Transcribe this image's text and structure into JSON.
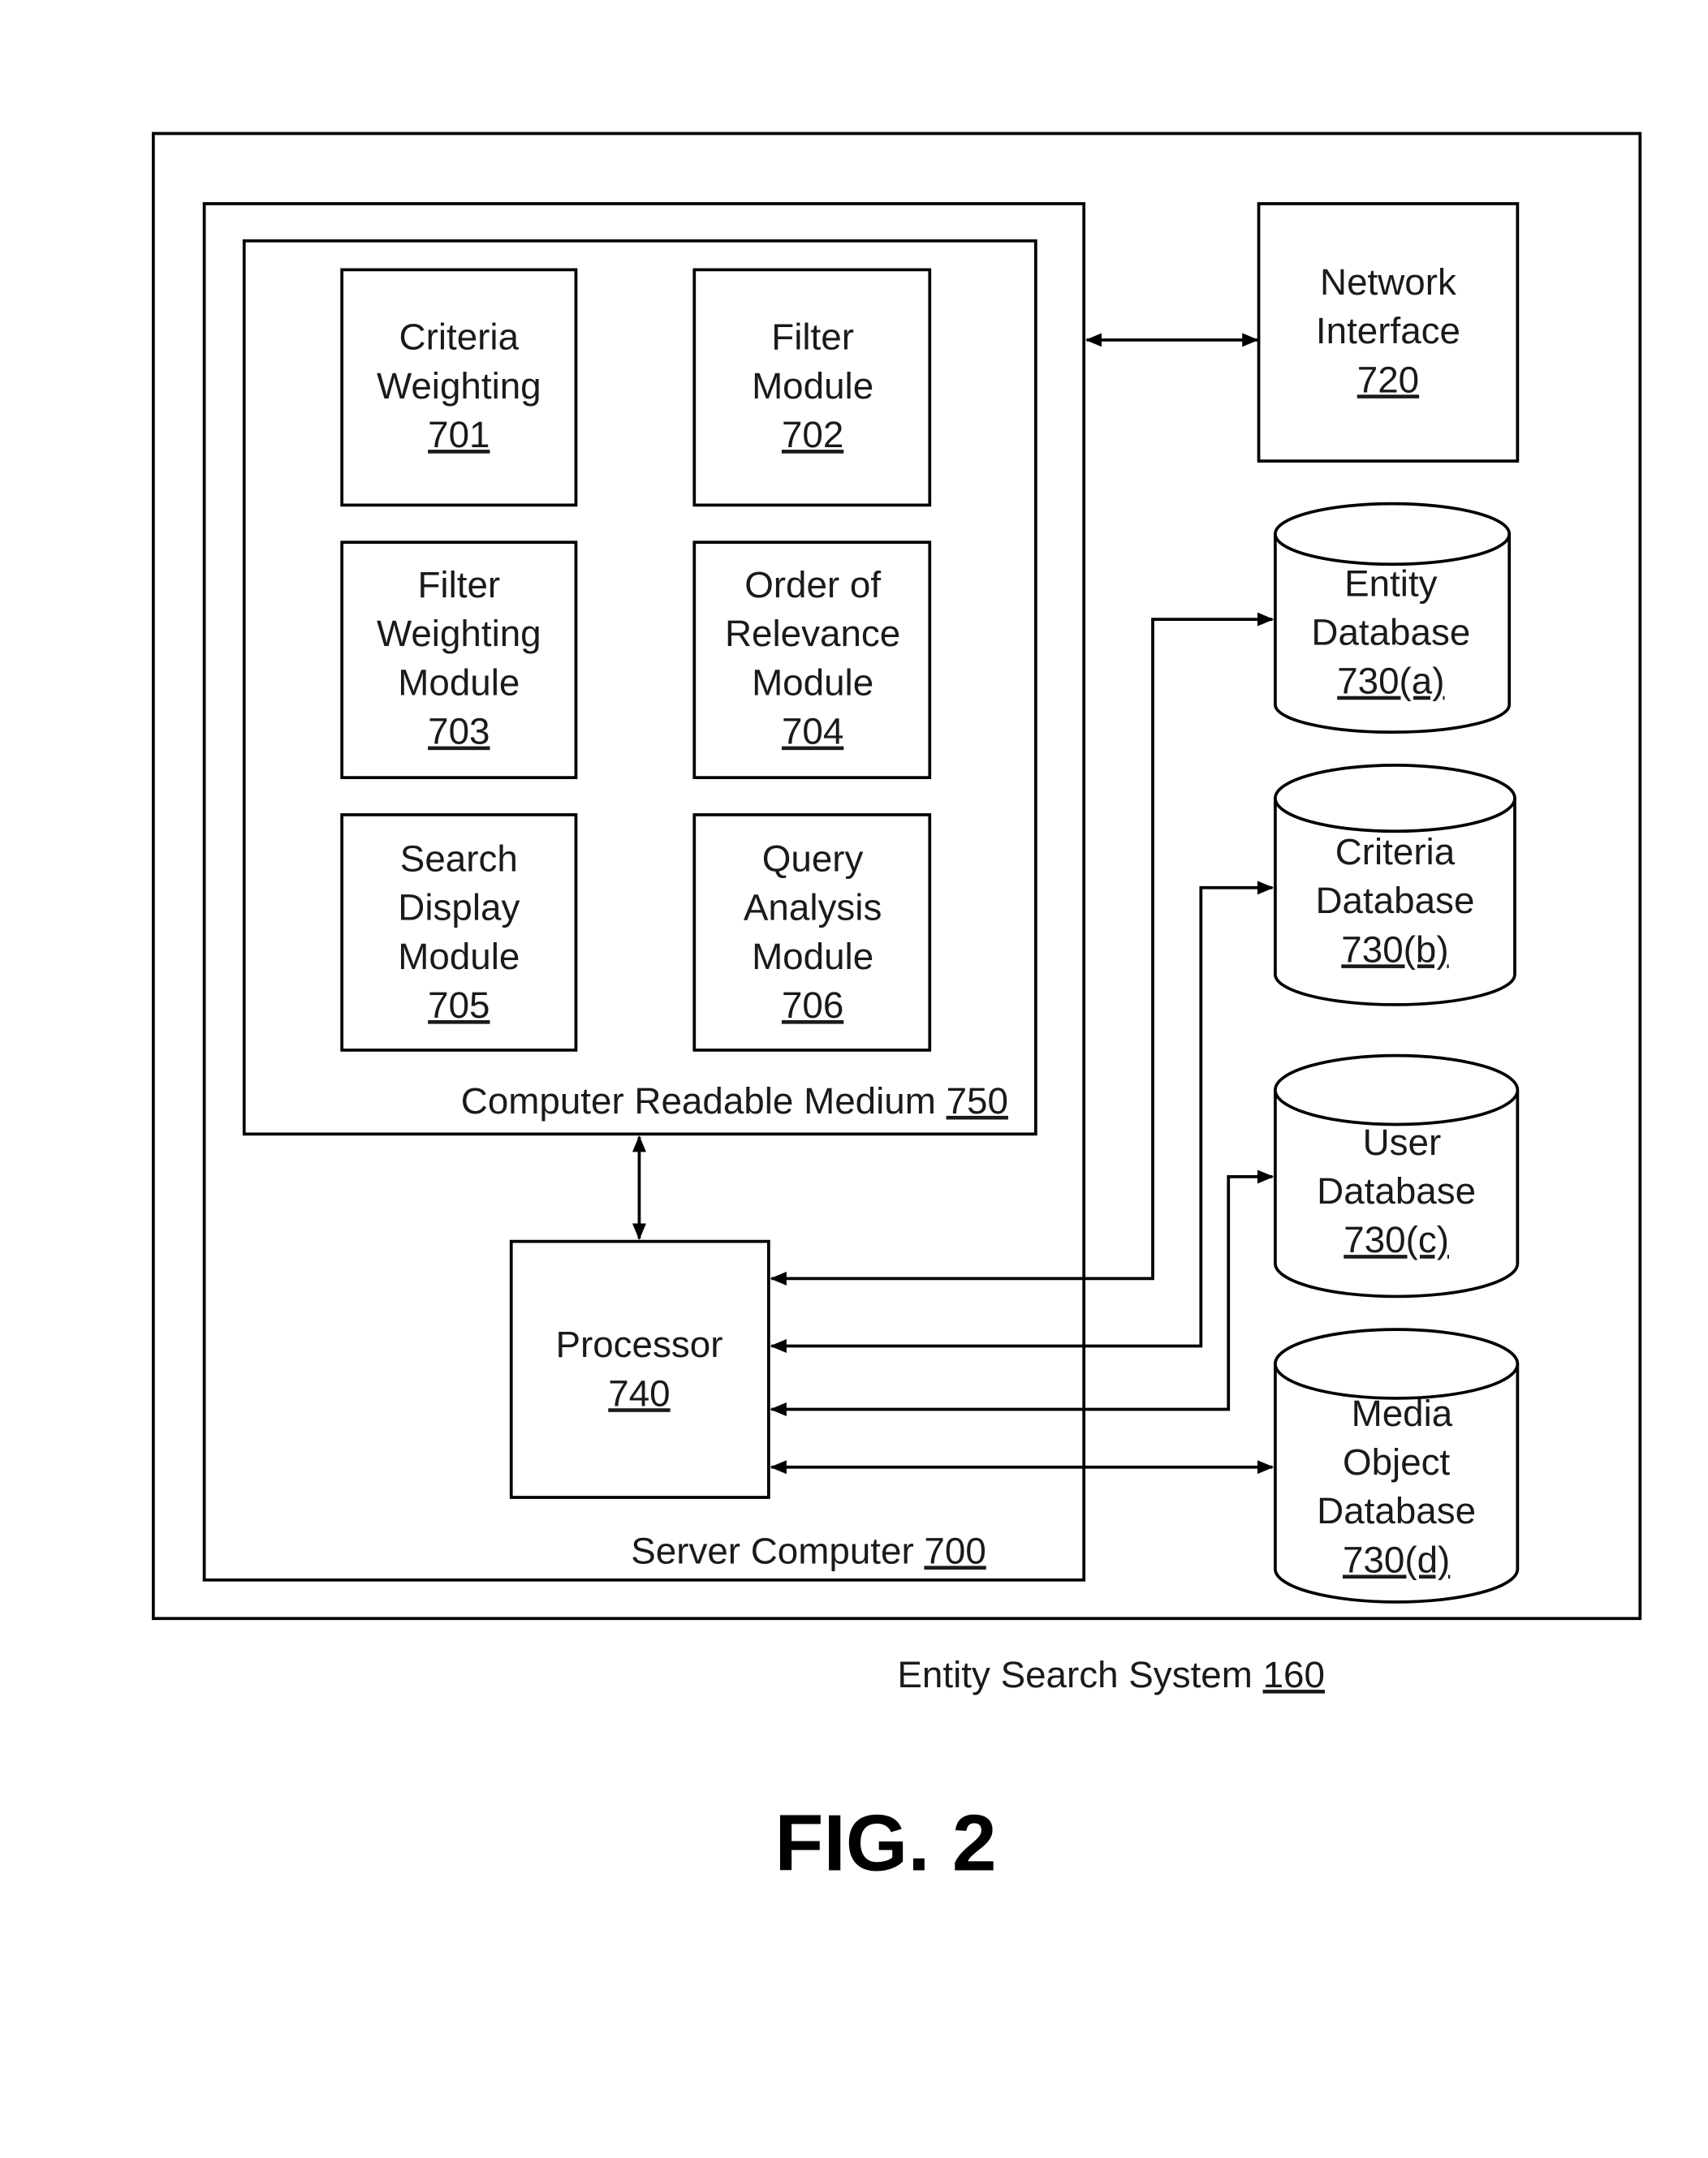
{
  "figure": {
    "label": "FIG. 2",
    "system": {
      "name": "Entity Search System",
      "ref": "160"
    },
    "server": {
      "name": "Server Computer",
      "ref": "700"
    },
    "medium": {
      "name": "Computer Readable Medium",
      "ref": "750"
    },
    "modules": [
      {
        "lines": [
          "Criteria",
          "Weighting"
        ],
        "ref": "701"
      },
      {
        "lines": [
          "Filter",
          "Module"
        ],
        "ref": "702"
      },
      {
        "lines": [
          "Filter",
          "Weighting",
          "Module"
        ],
        "ref": "703"
      },
      {
        "lines": [
          "Order of",
          "Relevance",
          "Module"
        ],
        "ref": "704"
      },
      {
        "lines": [
          "Search",
          "Display",
          "Module"
        ],
        "ref": "705"
      },
      {
        "lines": [
          "Query",
          "Analysis",
          "Module"
        ],
        "ref": "706"
      }
    ],
    "processor": {
      "name": "Processor",
      "ref": "740"
    },
    "network_interface": {
      "lines": [
        "Network",
        "Interface"
      ],
      "ref": "720"
    },
    "databases": [
      {
        "lines": [
          "Entity",
          "Database"
        ],
        "ref": "730(a)"
      },
      {
        "lines": [
          "Criteria",
          "Database"
        ],
        "ref": "730(b)"
      },
      {
        "lines": [
          "User",
          "Database"
        ],
        "ref": "730(c)"
      },
      {
        "lines": [
          "Media",
          "Object",
          "Database"
        ],
        "ref": "730(d)"
      }
    ]
  }
}
